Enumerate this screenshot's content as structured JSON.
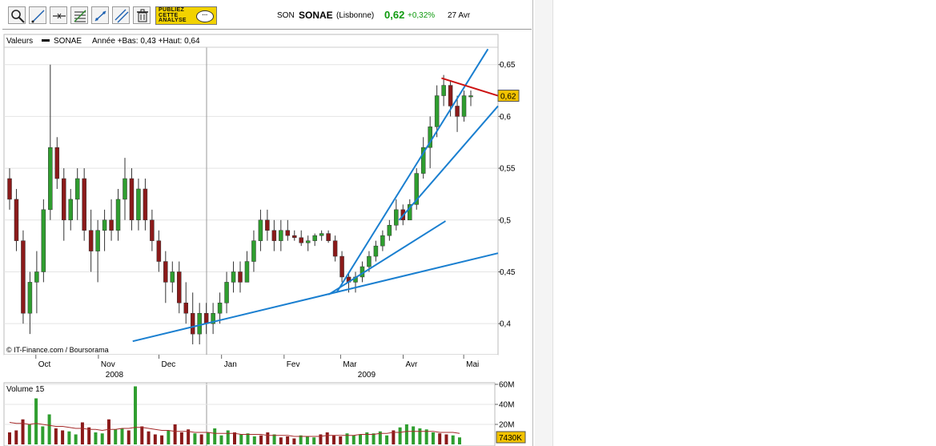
{
  "toolbar": {
    "tools": [
      "zoom-icon",
      "pencil-line-icon",
      "horizontal-line-icon",
      "fibonacci-icon",
      "trendline-icon",
      "parallel-lines-icon",
      "trash-icon"
    ],
    "promo": {
      "line1": "PUBLIEZ",
      "line2": "CETTE",
      "line3": "ANALYSE"
    }
  },
  "quote": {
    "code": "SON",
    "name": "SONAE",
    "place": "(Lisbonne)",
    "price": "0,62",
    "change": "+0,32%",
    "date": "27 Avr",
    "change_color": "#0e9a0e"
  },
  "chart_data": [
    {
      "type": "candlestick",
      "legend": {
        "label": "Valeurs",
        "series": "SONAE",
        "info": "Année +Bas: 0,43 +Haut: 0,64"
      },
      "credit": "© IT-Finance.com / Boursorama",
      "y_ticks": [
        "0,65",
        "0,6",
        "0,55",
        "0,5",
        "0,45",
        "0,4"
      ],
      "ylim": [
        0.37,
        0.666
      ],
      "x_months": [
        "Oct",
        "Nov",
        "Dec",
        "Jan",
        "Fev",
        "Mar",
        "Avr",
        "Mai"
      ],
      "x_years": [
        "2008",
        "2009"
      ],
      "last_price_label": "0,62",
      "colors": {
        "up": "#2f9e2f",
        "down": "#8b1a1a",
        "trend": "#1a7fd0",
        "resistance": "#cc1111",
        "last_label_bg": "#f2c200"
      },
      "candles": [
        [
          0.54,
          0.55,
          0.51,
          0.52
        ],
        [
          0.52,
          0.53,
          0.47,
          0.48
        ],
        [
          0.48,
          0.49,
          0.4,
          0.41
        ],
        [
          0.41,
          0.45,
          0.39,
          0.44
        ],
        [
          0.44,
          0.47,
          0.41,
          0.45
        ],
        [
          0.45,
          0.52,
          0.44,
          0.51
        ],
        [
          0.51,
          0.65,
          0.5,
          0.57
        ],
        [
          0.57,
          0.58,
          0.53,
          0.54
        ],
        [
          0.54,
          0.55,
          0.48,
          0.5
        ],
        [
          0.5,
          0.53,
          0.49,
          0.52
        ],
        [
          0.52,
          0.55,
          0.5,
          0.54
        ],
        [
          0.54,
          0.55,
          0.48,
          0.49
        ],
        [
          0.49,
          0.51,
          0.45,
          0.47
        ],
        [
          0.47,
          0.5,
          0.44,
          0.49
        ],
        [
          0.49,
          0.51,
          0.47,
          0.5
        ],
        [
          0.5,
          0.52,
          0.48,
          0.49
        ],
        [
          0.49,
          0.53,
          0.48,
          0.52
        ],
        [
          0.52,
          0.56,
          0.5,
          0.54
        ],
        [
          0.54,
          0.55,
          0.49,
          0.5
        ],
        [
          0.5,
          0.54,
          0.49,
          0.53
        ],
        [
          0.53,
          0.54,
          0.49,
          0.5
        ],
        [
          0.5,
          0.51,
          0.47,
          0.48
        ],
        [
          0.48,
          0.49,
          0.45,
          0.46
        ],
        [
          0.46,
          0.47,
          0.42,
          0.44
        ],
        [
          0.44,
          0.46,
          0.43,
          0.45
        ],
        [
          0.45,
          0.46,
          0.41,
          0.42
        ],
        [
          0.42,
          0.44,
          0.4,
          0.41
        ],
        [
          0.41,
          0.43,
          0.38,
          0.39
        ],
        [
          0.39,
          0.42,
          0.38,
          0.41
        ],
        [
          0.41,
          0.42,
          0.39,
          0.4
        ],
        [
          0.4,
          0.42,
          0.39,
          0.41
        ],
        [
          0.41,
          0.43,
          0.4,
          0.42
        ],
        [
          0.42,
          0.45,
          0.41,
          0.44
        ],
        [
          0.44,
          0.46,
          0.43,
          0.45
        ],
        [
          0.45,
          0.46,
          0.43,
          0.44
        ],
        [
          0.44,
          0.47,
          0.44,
          0.46
        ],
        [
          0.46,
          0.49,
          0.45,
          0.48
        ],
        [
          0.48,
          0.51,
          0.47,
          0.5
        ],
        [
          0.5,
          0.51,
          0.48,
          0.49
        ],
        [
          0.49,
          0.5,
          0.47,
          0.48
        ],
        [
          0.48,
          0.5,
          0.47,
          0.49
        ],
        [
          0.49,
          0.5,
          0.48,
          0.485
        ],
        [
          0.485,
          0.49,
          0.48,
          0.483
        ],
        [
          0.483,
          0.49,
          0.475,
          0.478
        ],
        [
          0.478,
          0.485,
          0.47,
          0.48
        ],
        [
          0.48,
          0.487,
          0.475,
          0.485
        ],
        [
          0.485,
          0.49,
          0.48,
          0.487
        ],
        [
          0.487,
          0.49,
          0.478,
          0.48
        ],
        [
          0.48,
          0.485,
          0.46,
          0.465
        ],
        [
          0.465,
          0.47,
          0.44,
          0.445
        ],
        [
          0.445,
          0.45,
          0.43,
          0.44
        ],
        [
          0.44,
          0.45,
          0.43,
          0.445
        ],
        [
          0.445,
          0.46,
          0.44,
          0.455
        ],
        [
          0.455,
          0.47,
          0.45,
          0.465
        ],
        [
          0.465,
          0.48,
          0.46,
          0.475
        ],
        [
          0.475,
          0.49,
          0.47,
          0.485
        ],
        [
          0.485,
          0.5,
          0.48,
          0.495
        ],
        [
          0.495,
          0.52,
          0.49,
          0.51
        ],
        [
          0.51,
          0.515,
          0.495,
          0.5
        ],
        [
          0.5,
          0.52,
          0.5,
          0.515
        ],
        [
          0.515,
          0.55,
          0.51,
          0.545
        ],
        [
          0.545,
          0.58,
          0.54,
          0.57
        ],
        [
          0.57,
          0.6,
          0.55,
          0.59
        ],
        [
          0.59,
          0.63,
          0.58,
          0.62
        ],
        [
          0.62,
          0.64,
          0.61,
          0.63
        ],
        [
          0.63,
          0.635,
          0.6,
          0.61
        ],
        [
          0.61,
          0.62,
          0.585,
          0.6
        ],
        [
          0.6,
          0.625,
          0.595,
          0.62
        ],
        [
          0.62,
          0.625,
          0.61,
          0.62
        ]
      ],
      "trendlines": [
        {
          "from": [
            "2008-11-18",
            0.383
          ],
          "to": [
            "2009-05-18",
            0.468
          ],
          "color": "#1a7fd0"
        },
        {
          "from": [
            "2009-02-23",
            0.428
          ],
          "to": [
            "2009-04-22",
            0.499
          ],
          "color": "#1a7fd0"
        },
        {
          "from": [
            "2009-03-30",
            0.5
          ],
          "to": [
            "2009-05-18",
            0.61
          ],
          "color": "#1a7fd0"
        },
        {
          "from": [
            "2009-02-27",
            0.43
          ],
          "to": [
            "2009-05-13",
            0.665
          ],
          "color": "#1a7fd0"
        },
        {
          "from": [
            "2009-04-20",
            0.637
          ],
          "to": [
            "2009-05-18",
            0.62
          ],
          "color": "#cc1111"
        }
      ]
    },
    {
      "type": "bar",
      "title": "Volume 15",
      "y_ticks": [
        "60M",
        "40M",
        "20M"
      ],
      "ylim": [
        0,
        60
      ],
      "last_volume_label": "7430K",
      "volumes": [
        12,
        14,
        25,
        20,
        46,
        18,
        30,
        16,
        14,
        13,
        10,
        22,
        17,
        12,
        11,
        25,
        15,
        16,
        14,
        58,
        18,
        13,
        10,
        9,
        14,
        20,
        12,
        15,
        11,
        10,
        12,
        16,
        9,
        14,
        12,
        10,
        11,
        8,
        9,
        12,
        10,
        7,
        8,
        6,
        9,
        8,
        7,
        10,
        12,
        9,
        8,
        11,
        9,
        10,
        12,
        11,
        13,
        9,
        14,
        17,
        20,
        18,
        16,
        15,
        12,
        11,
        10,
        9,
        7
      ],
      "ma": [
        22,
        21,
        21,
        20,
        21,
        20,
        19,
        18,
        18,
        17,
        16,
        16,
        15,
        15,
        14,
        15,
        15,
        16,
        16,
        17,
        17,
        16,
        15,
        14,
        14,
        13,
        13,
        13,
        12,
        12,
        12,
        11,
        11,
        11,
        11,
        10,
        10,
        10,
        10,
        9,
        9,
        9,
        9,
        8,
        8,
        8,
        8,
        8,
        9,
        9,
        9,
        9,
        9,
        10,
        10,
        10,
        11,
        11,
        12,
        12,
        13,
        13,
        13,
        13,
        13,
        12,
        12,
        12,
        11
      ],
      "colors": {
        "up": "#2f9e2f",
        "down": "#8b1a1a",
        "ma": "#a52a2a"
      }
    }
  ]
}
